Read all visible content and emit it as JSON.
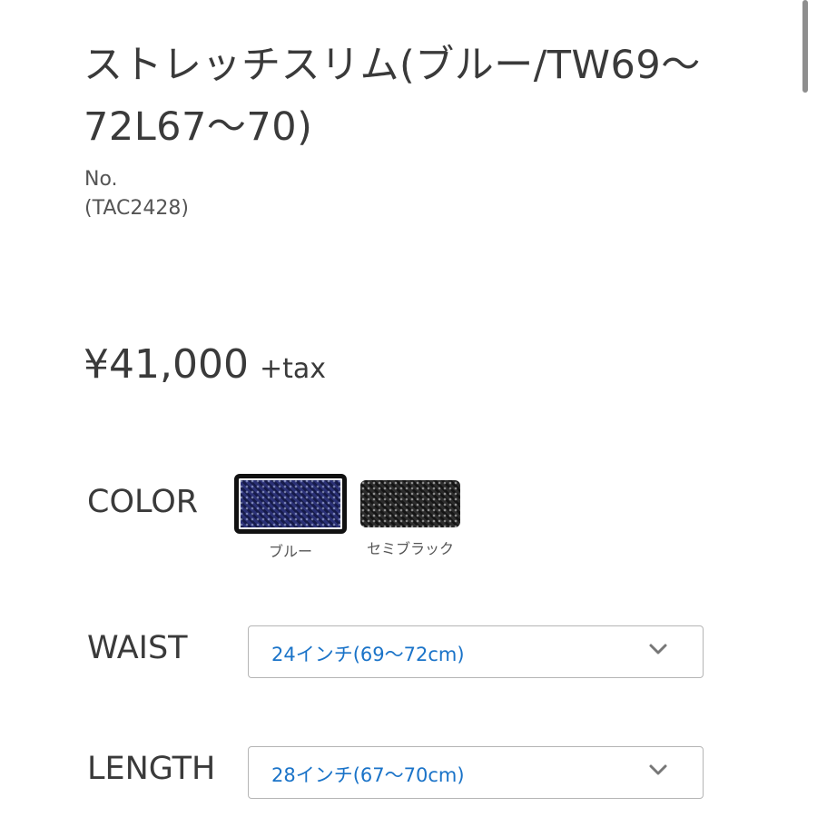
{
  "product": {
    "title": "ストレッチスリム(ブルー/TW69〜72L67〜70)",
    "number_label": "No.",
    "number_value": "(TAC2428)"
  },
  "price": {
    "amount": "¥41,000",
    "tax": "+tax"
  },
  "color": {
    "label": "COLOR",
    "selected": "ブルー",
    "options": [
      {
        "name": "ブルー",
        "swatch_color": "#1f2563"
      },
      {
        "name": "セミブラック",
        "swatch_color": "#202020"
      }
    ]
  },
  "waist": {
    "label": "WAIST",
    "selected_value": "24インチ(69〜72cm)"
  },
  "length": {
    "label": "LENGTH",
    "selected_value": "28インチ(67〜70cm)"
  },
  "icons": {
    "chevron": "chevron-down-icon"
  },
  "colors": {
    "text": "#3a3a3a",
    "select_value": "#1a73c8",
    "select_border": "#b5b5b5"
  }
}
